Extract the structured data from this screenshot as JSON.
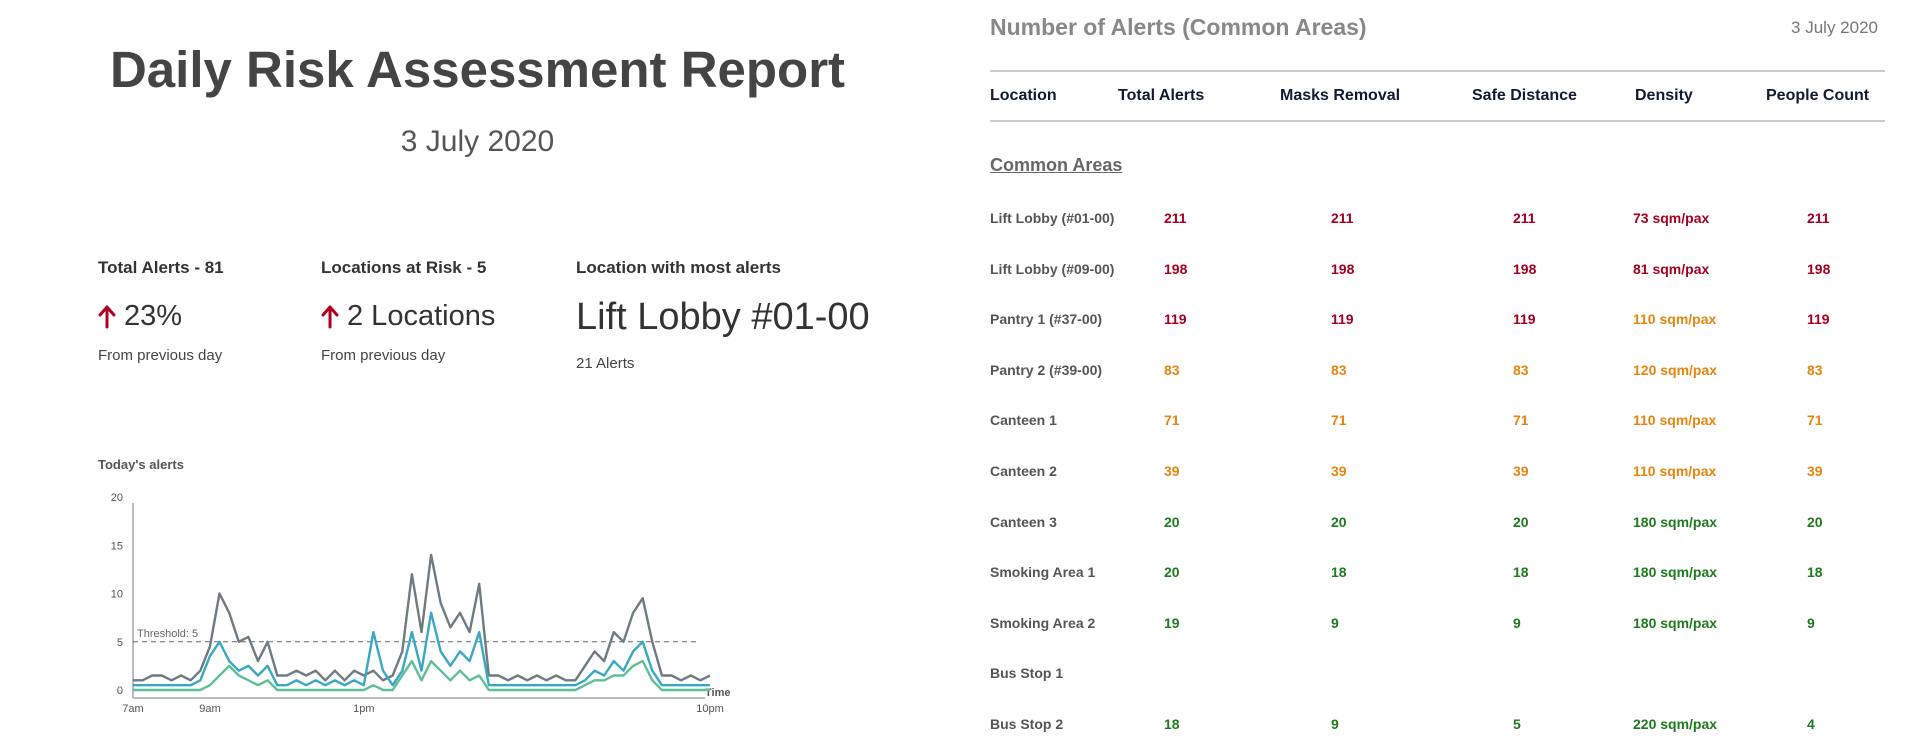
{
  "report": {
    "title": "Daily Risk Assessment Report",
    "date": "3 July 2020"
  },
  "stats": [
    {
      "label": "Total Alerts - 81",
      "main": "23%",
      "sub": "From previous day",
      "trend": "up",
      "trend_color": "#b00020"
    },
    {
      "label": "Locations at Risk - 5",
      "main": "2 Locations",
      "sub": "From previous day",
      "trend": "up",
      "trend_color": "#b00020"
    },
    {
      "label": "Location with most alerts",
      "main": "Lift Lobby #01-00",
      "sub": "21 Alerts"
    }
  ],
  "chart": {
    "title": "Today's alerts",
    "xlabel": "Time",
    "threshold_label": "Threshold: 5"
  },
  "chart_data": {
    "type": "line",
    "title": "Today's alerts",
    "xlabel": "Time",
    "ylabel": "",
    "ylim": [
      0,
      20
    ],
    "yticks": [
      0,
      5,
      10,
      15,
      20
    ],
    "xlim": [
      7,
      22
    ],
    "xticks": [
      {
        "value": 7,
        "label": "7am"
      },
      {
        "value": 9,
        "label": "9am"
      },
      {
        "value": 13,
        "label": "1pm"
      },
      {
        "value": 22,
        "label": "10pm"
      }
    ],
    "threshold": 5,
    "grid": false,
    "x": [
      7.0,
      7.25,
      7.5,
      7.75,
      8.0,
      8.25,
      8.5,
      8.75,
      9.0,
      9.25,
      9.5,
      9.75,
      10.0,
      10.25,
      10.5,
      10.75,
      11.0,
      11.25,
      11.5,
      11.75,
      12.0,
      12.25,
      12.5,
      12.75,
      13.0,
      13.25,
      13.5,
      13.75,
      14.0,
      14.25,
      14.5,
      14.75,
      15.0,
      15.25,
      15.5,
      15.75,
      16.0,
      16.25,
      16.5,
      16.75,
      17.0,
      17.25,
      17.5,
      17.75,
      18.0,
      18.25,
      18.5,
      18.75,
      19.0,
      19.25,
      19.5,
      19.75,
      20.0,
      20.25,
      20.5,
      20.75,
      21.0,
      21.25,
      21.5,
      21.75,
      22.0
    ],
    "series": [
      {
        "color": "#6e7b80",
        "values": [
          1,
          1,
          1.5,
          1.5,
          1,
          1.5,
          1,
          2,
          4.5,
          10,
          8,
          5,
          5.5,
          3,
          5,
          1.5,
          1.5,
          2,
          1.5,
          2,
          1,
          2,
          1,
          2,
          1.5,
          2,
          1,
          1.5,
          4,
          12,
          6,
          14,
          9,
          6.5,
          8,
          6,
          11,
          1.5,
          1.5,
          1,
          1.5,
          1,
          1.5,
          1,
          1.5,
          1,
          1,
          2.5,
          4,
          3,
          6,
          5,
          8,
          9.5,
          5,
          1.5,
          1.5,
          1,
          1.5,
          1,
          1.5
        ]
      },
      {
        "color": "#3aa8c1",
        "values": [
          0.5,
          0.5,
          0.5,
          0.5,
          0.5,
          0.5,
          0.5,
          1,
          3.5,
          5,
          3,
          2,
          2.5,
          1.5,
          2.5,
          0.5,
          0.5,
          1,
          0.5,
          1,
          0.5,
          1,
          0.5,
          1,
          0.5,
          6,
          2,
          0.5,
          2,
          6,
          2,
          8,
          4,
          2.5,
          4,
          3,
          6,
          0.5,
          0.5,
          0.5,
          0.5,
          0.5,
          0.5,
          0.5,
          0.5,
          0.5,
          0.5,
          1,
          2,
          1.5,
          3,
          2,
          4,
          5,
          2,
          0.5,
          0.5,
          0.5,
          0.5,
          0.5,
          0.5
        ]
      },
      {
        "color": "#5cbf95",
        "values": [
          0,
          0,
          0,
          0,
          0,
          0,
          0,
          0,
          0.5,
          1.5,
          2.5,
          1.5,
          1,
          0.5,
          1,
          0,
          0,
          0,
          0,
          0,
          0,
          0,
          0,
          0,
          0,
          0.5,
          0,
          0,
          1.5,
          3,
          1,
          3,
          2,
          1,
          2,
          1,
          1.5,
          0,
          0,
          0,
          0,
          0,
          0,
          0,
          0,
          0,
          0,
          0.5,
          1,
          1,
          1.5,
          1.5,
          2.5,
          3,
          1,
          0,
          0,
          0,
          0,
          0,
          0
        ]
      }
    ]
  },
  "table": {
    "title": "Number of Alerts (Common Areas)",
    "date": "3 July 2020",
    "headers": [
      "Location",
      "Total Alerts",
      "Masks Removal",
      "Safe Distance",
      "Density",
      "People Count"
    ],
    "section": "Common Areas",
    "rows": [
      {
        "location": "Lift Lobby (#01-00)",
        "total": "211",
        "masks": "211",
        "safe": "211",
        "density": "73 sqm/pax",
        "people": "211",
        "color": "#a50021"
      },
      {
        "location": "Lift Lobby (#09-00)",
        "total": "198",
        "masks": "198",
        "safe": "198",
        "density": "81 sqm/pax",
        "people": "198",
        "color": "#a50021"
      },
      {
        "location": "Pantry 1 (#37-00)",
        "total": "119",
        "masks": "119",
        "safe": "119",
        "density": "110 sqm/pax",
        "people": "119",
        "color": "#a50021",
        "density_color": "#e6850e"
      },
      {
        "location": "Pantry 2 (#39-00)",
        "total": "83",
        "masks": "83",
        "safe": "83",
        "density": "120 sqm/pax",
        "people": "83",
        "color": "#e6850e"
      },
      {
        "location": "Canteen 1",
        "total": "71",
        "masks": "71",
        "safe": "71",
        "density": "110 sqm/pax",
        "people": "71",
        "color": "#e6850e"
      },
      {
        "location": "Canteen 2",
        "total": "39",
        "masks": "39",
        "safe": "39",
        "density": "110 sqm/pax",
        "people": "39",
        "color": "#e6850e"
      },
      {
        "location": "Canteen 3",
        "total": "20",
        "masks": "20",
        "safe": "20",
        "density": "180 sqm/pax",
        "people": "20",
        "color": "#1e7a1e"
      },
      {
        "location": "Smoking Area 1",
        "total": "20",
        "masks": "18",
        "safe": "18",
        "density": "180 sqm/pax",
        "people": "18",
        "color": "#1e7a1e"
      },
      {
        "location": "Smoking Area 2",
        "total": "19",
        "masks": "9",
        "safe": "9",
        "density": "180 sqm/pax",
        "people": "9",
        "color": "#1e7a1e"
      },
      {
        "location": "Bus Stop 1",
        "total": "",
        "masks": "",
        "safe": "",
        "density": "",
        "people": "",
        "color": "#1e7a1e"
      },
      {
        "location": "Bus Stop 2",
        "total": "18",
        "masks": "9",
        "safe": "5",
        "density": "220 sqm/pax",
        "people": "4",
        "color": "#1e7a1e"
      }
    ]
  }
}
